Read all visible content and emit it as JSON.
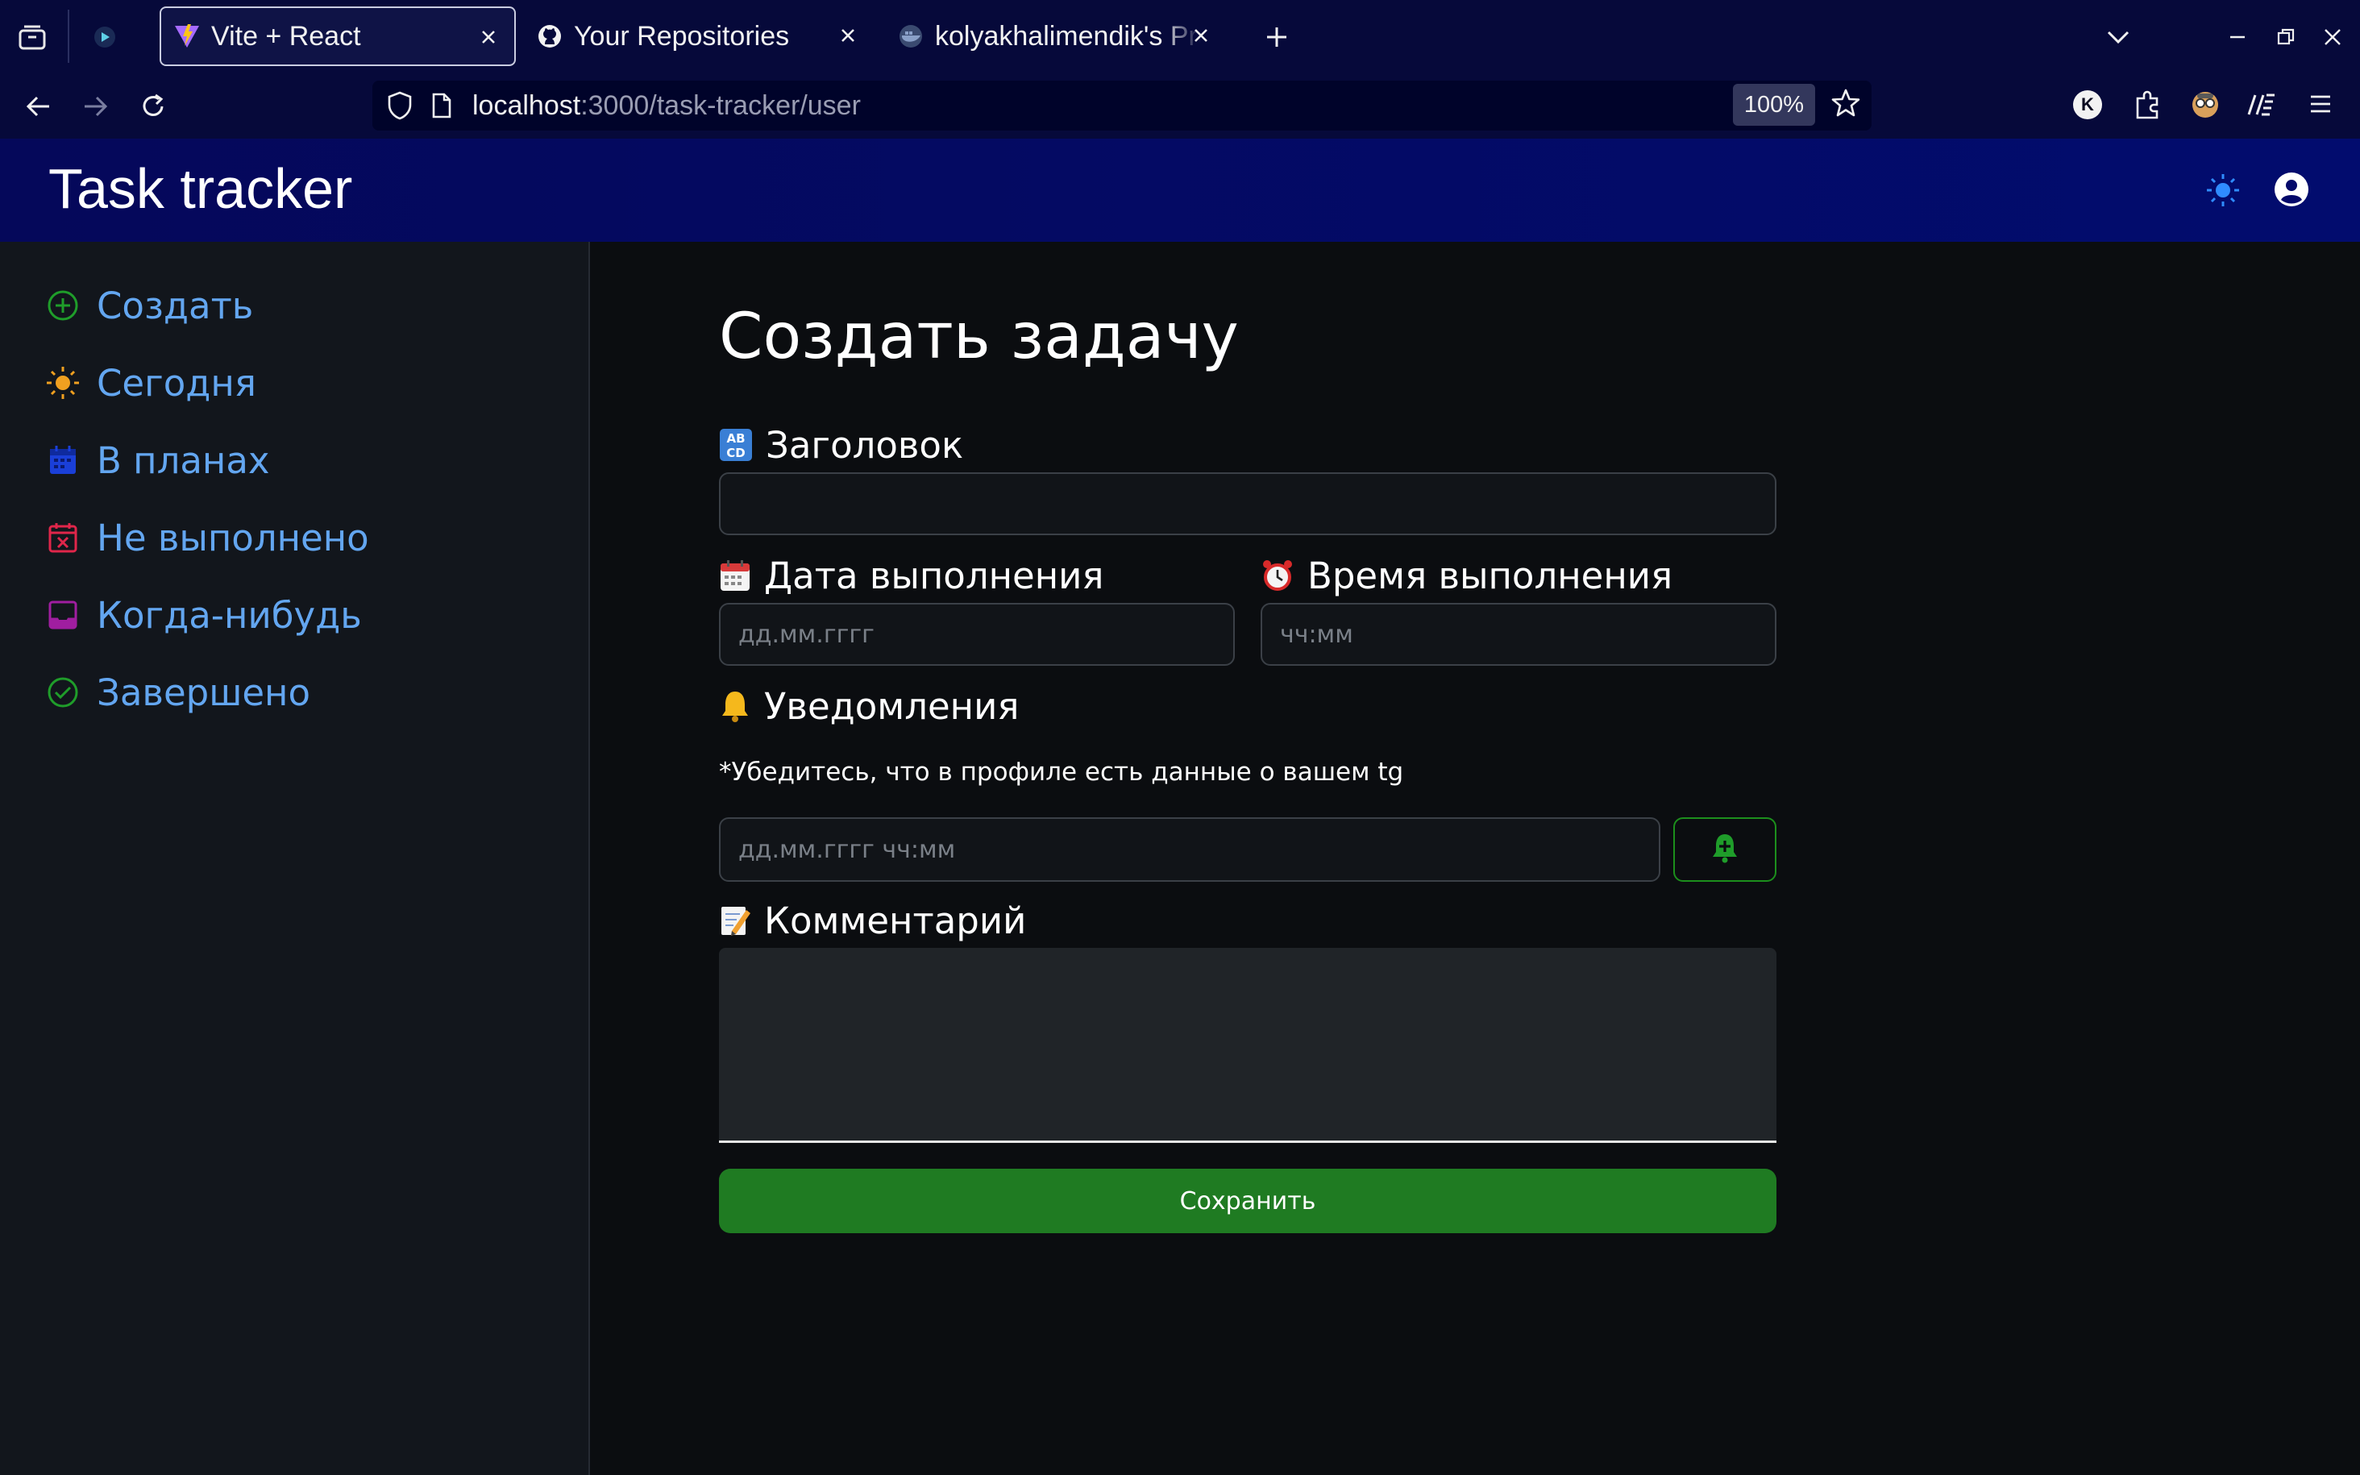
{
  "browser": {
    "tabs": [
      {
        "title": "Vite + React",
        "active": true
      },
      {
        "title": "Your Repositories",
        "active": false
      },
      {
        "title": "kolyakhalimendik's Pro",
        "active": false
      }
    ],
    "url_host": "localhost",
    "url_path": ":3000/task-tracker/user",
    "zoom": "100%",
    "extension_badge": "K"
  },
  "app": {
    "title": "Task tracker"
  },
  "sidebar": {
    "items": [
      {
        "label": "Создать",
        "icon": "plus-circle-icon",
        "color": "#1f9d2a"
      },
      {
        "label": "Сегодня",
        "icon": "sun-icon",
        "color": "#f0a020"
      },
      {
        "label": "В планах",
        "icon": "calendar-icon",
        "color": "#1a3fd8"
      },
      {
        "label": "Не выполнено",
        "icon": "calendar-x-icon",
        "color": "#e0264a"
      },
      {
        "label": "Когда-нибудь",
        "icon": "inbox-icon",
        "color": "#a01ea0"
      },
      {
        "label": "Завершено",
        "icon": "check-circle-icon",
        "color": "#1f9d2a"
      }
    ]
  },
  "form": {
    "heading": "Создать задачу",
    "title_label": "Заголовок",
    "title_value": "",
    "date_label": "Дата выполнения",
    "date_placeholder": "дд.мм.гггг",
    "time_label": "Время выполнения",
    "time_placeholder": "чч:мм",
    "notify_label": "Уведомления",
    "notify_hint": "*Убедитесь, что в профиле есть данные о вашем tg",
    "notify_placeholder": "дд.мм.гггг чч:мм",
    "comment_label": "Комментарий",
    "comment_value": "",
    "save_label": "Сохранить"
  },
  "colors": {
    "accent_link": "#63a6f0",
    "header_bg": "#020c6e",
    "save_green": "#1f7b22"
  }
}
